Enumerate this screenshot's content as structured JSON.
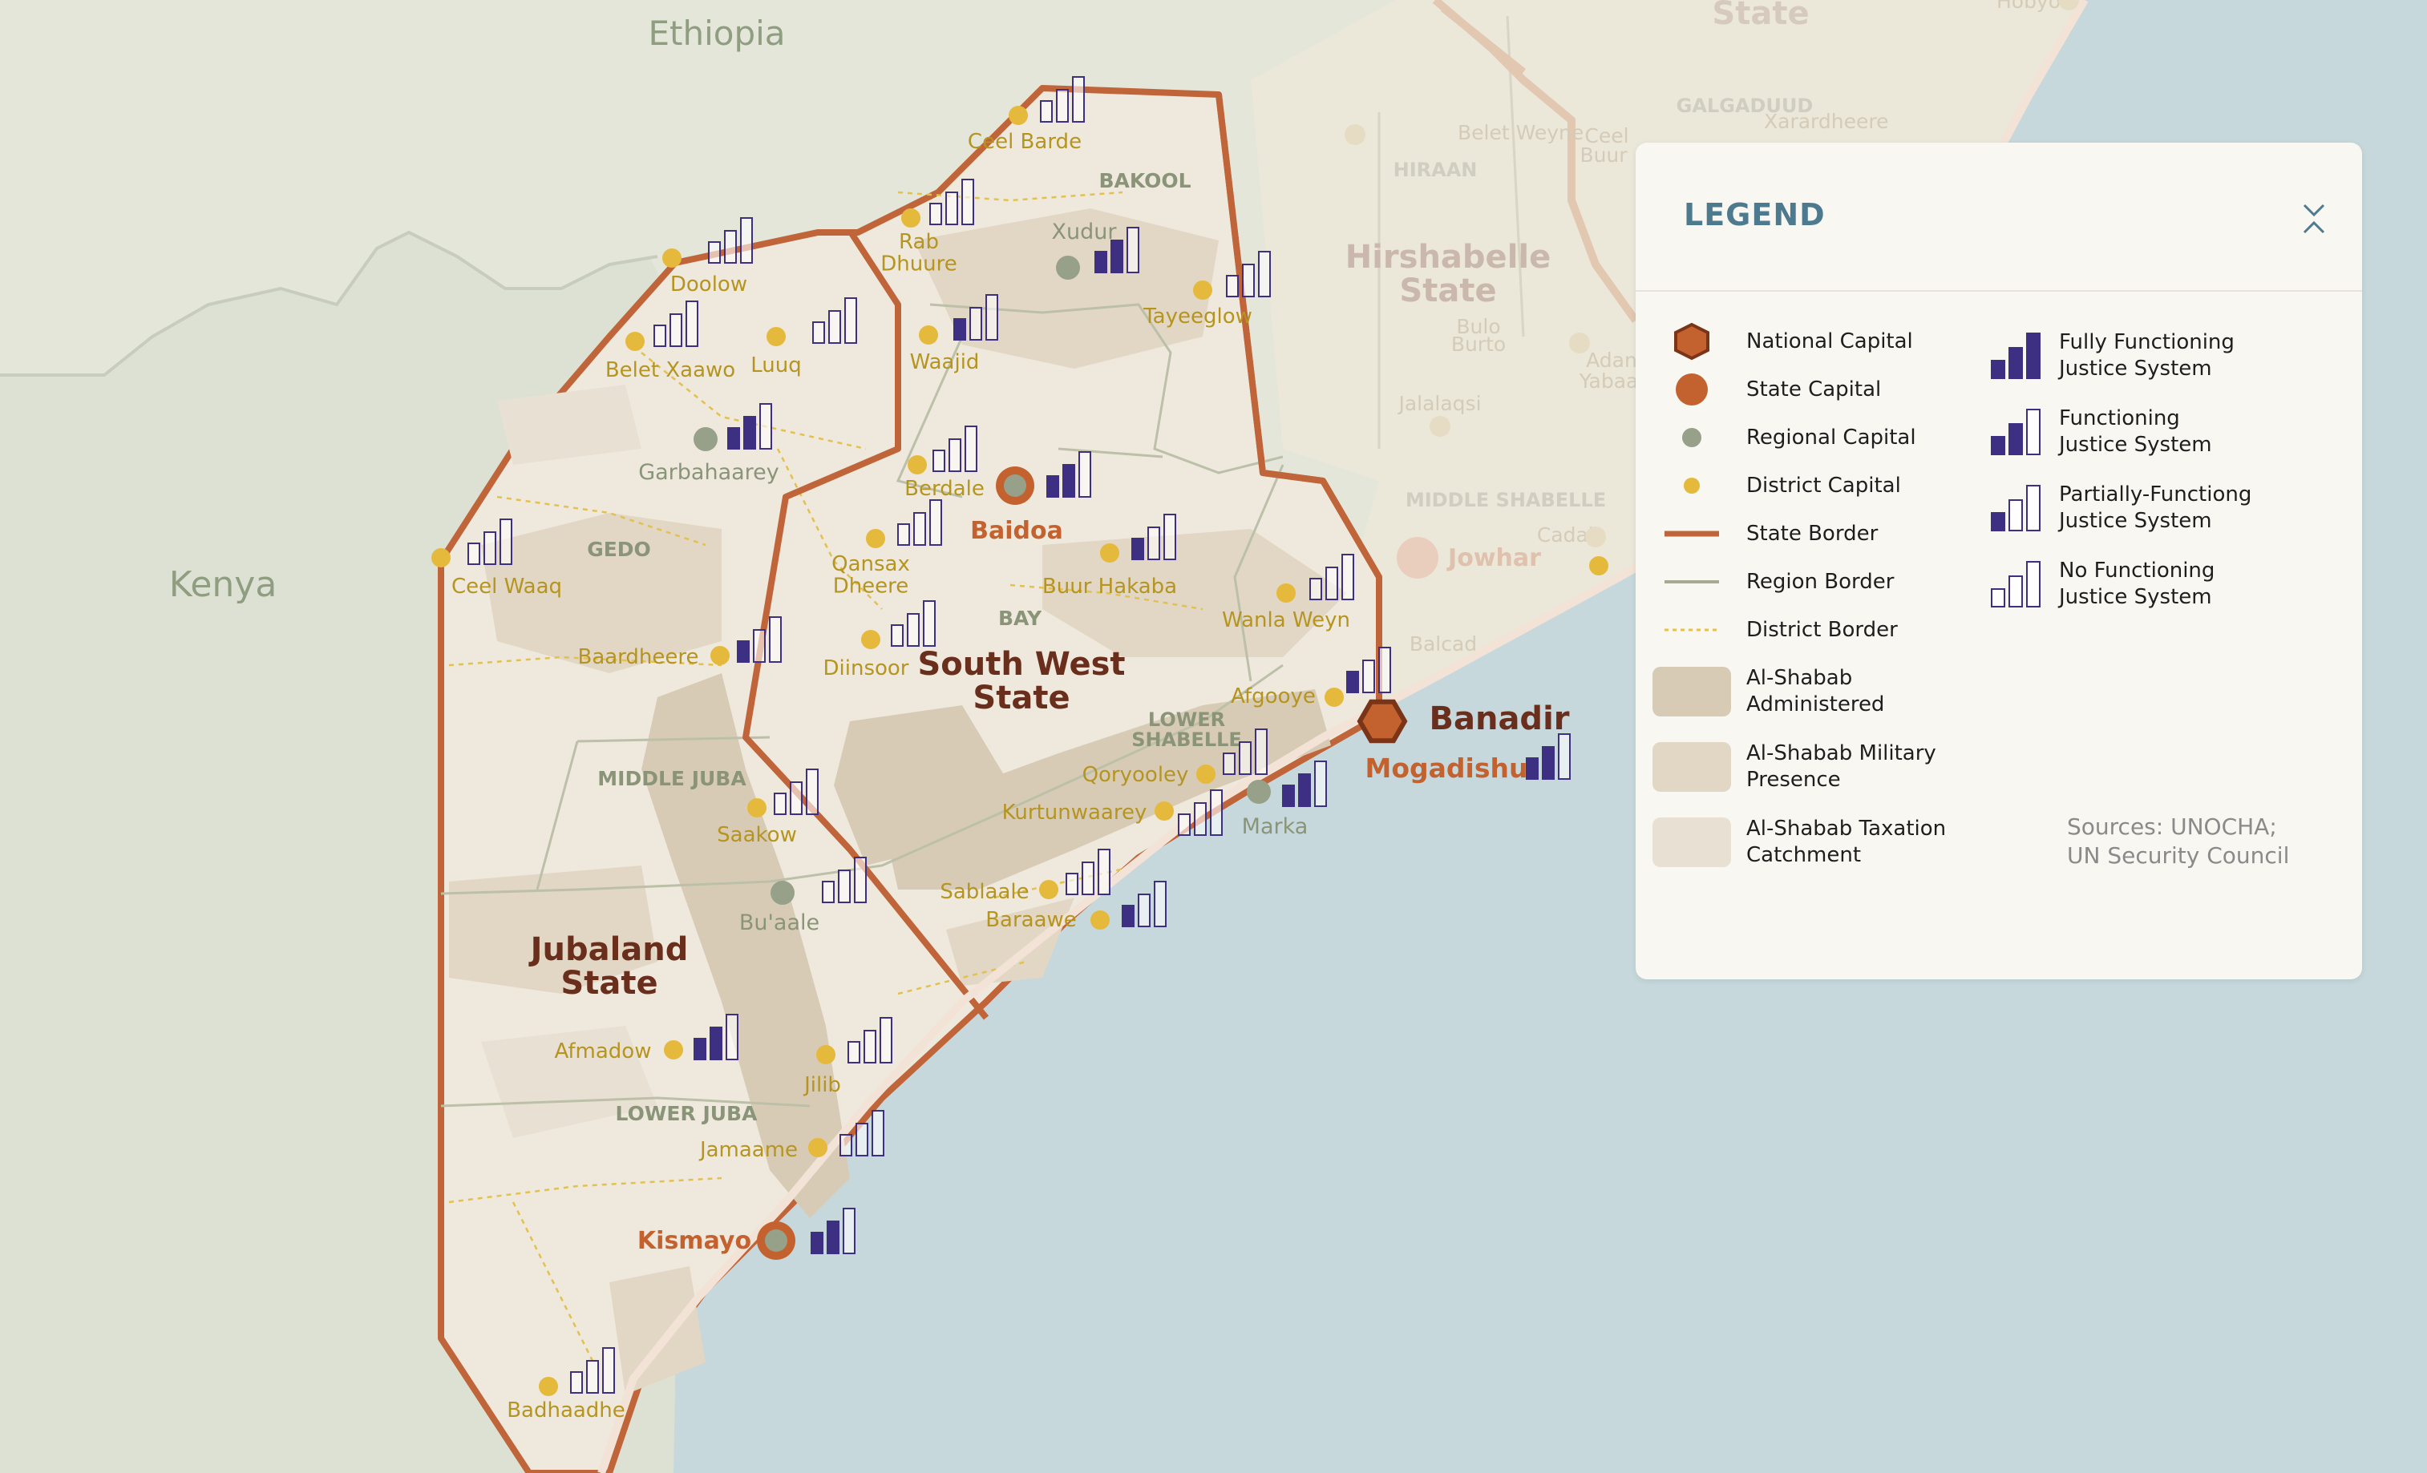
{
  "countries": [
    "Ethiopia",
    "Kenya"
  ],
  "states": {
    "south_west": [
      "South West",
      "State"
    ],
    "jubaland": [
      "Jubaland",
      "State"
    ],
    "hirshabelle": [
      "Hirshabelle",
      "State"
    ],
    "banadir": "Banadir",
    "top_partial": "State"
  },
  "regions": {
    "bakool": "BAKOOL",
    "gedo": "GEDO",
    "bay": "BAY",
    "middle_juba": "MIDDLE JUBA",
    "lower_juba": "LOWER JUBA",
    "lower_shabelle": [
      "LOWER",
      "SHABELLE"
    ],
    "hiraan": "HIRAAN",
    "middle_shabelle": "MIDDLE SHABELLE",
    "galgaduud": "GALGADUUD"
  },
  "capitals": {
    "national": "Mogadishu",
    "state": [
      "Baidoa",
      "Kismayo"
    ],
    "faded_state": "Jowhar"
  },
  "regional_capitals": [
    "Xudur",
    "Garbahaarey",
    "Bu'aale",
    "Marka"
  ],
  "district_capitals": {
    "ceel_barde": "Ceel Barde",
    "rab_dhuure": [
      "Rab",
      "Dhuure"
    ],
    "doolow": "Doolow",
    "belet_xaawo": "Belet Xaawo",
    "luuq": "Luuq",
    "waajid": "Waajid",
    "tayeeglow": "Tayeeglow",
    "berdale": "Berdale",
    "ceel_waaq": "Ceel Waaq",
    "qansax_dheere": [
      "Qansax",
      "Dheere"
    ],
    "buur_hakaba": "Buur Hakaba",
    "wanla_weyn": "Wanla Weyn",
    "baardheere": "Baardheere",
    "diinsoor": "Diinsoor",
    "afgooye": "Afgooye",
    "qoryooley": "Qoryooley",
    "kurtunwaarey": "Kurtunwaarey",
    "saakow": "Saakow",
    "sablaale": "Sablaale",
    "baraawe": "Baraawe",
    "afmadow": "Afmadow",
    "jilib": "Jilib",
    "jamaame": "Jamaame",
    "badhaadhe": "Badhaadhe"
  },
  "faded_places": [
    "Belet Weyne",
    "Bulo",
    "Burto",
    "Jalalaqsi",
    "Adan",
    "Yabaal",
    "Cadale",
    "Balcad",
    "Ceel",
    "Buur",
    "Xarardheere",
    "Hobyo"
  ],
  "legend": {
    "title": "LEGEND",
    "items_left": [
      {
        "icon": "national-capital-icon",
        "label": "National Capital"
      },
      {
        "icon": "state-capital-icon",
        "label": "State Capital"
      },
      {
        "icon": "regional-capital-icon",
        "label": "Regional Capital"
      },
      {
        "icon": "district-capital-icon",
        "label": "District Capital"
      },
      {
        "icon": "state-border-icon",
        "label": "State Border"
      },
      {
        "icon": "region-border-icon",
        "label": "Region Border"
      },
      {
        "icon": "district-border-icon",
        "label": "District Border"
      },
      {
        "icon": "al-shabab-administered-swatch",
        "label": [
          "Al-Shabab",
          "Administered"
        ]
      },
      {
        "icon": "al-shabab-military-swatch",
        "label": [
          "Al-Shabab Military",
          "Presence"
        ]
      },
      {
        "icon": "al-shabab-taxation-swatch",
        "label": [
          "Al-Shabab Taxation",
          "Catchment"
        ]
      }
    ],
    "items_right": [
      {
        "icon": "fully-functioning-icon",
        "label": [
          "Fully Functioning",
          "Justice System"
        ],
        "level": 3
      },
      {
        "icon": "functioning-icon",
        "label": [
          "Functioning",
          "Justice System"
        ],
        "level": 2
      },
      {
        "icon": "partially-functioning-icon",
        "label": [
          "Partially-Functiong",
          "Justice System"
        ],
        "level": 1
      },
      {
        "icon": "no-functioning-icon",
        "label": [
          "No Functioning",
          "Justice System"
        ],
        "level": 0
      }
    ],
    "sources": [
      "Sources: UNOCHA;",
      "UN Security Council"
    ]
  },
  "colors": {
    "sea": "#c6d8dc",
    "land_outside": "#e4e6da",
    "somalia_land": "#efe9dd",
    "state_border": "#c0653a",
    "region_border": "#a6ab8f",
    "district_border": "#e3c14e",
    "district_dot": "#e4b93c",
    "district_label": "#b59520",
    "regional_dot": "#97a189",
    "state_capital": "#c3622e",
    "state_name": "#6a2e1d",
    "region_label": "#8a9478",
    "justice_bar": "#3d2f82",
    "al_shabab_admin": "#d8cbb6",
    "al_shabab_military": "#e2d6c4",
    "al_shabab_tax": "#e8e0d2",
    "legend_title": "#4d7a8e"
  }
}
